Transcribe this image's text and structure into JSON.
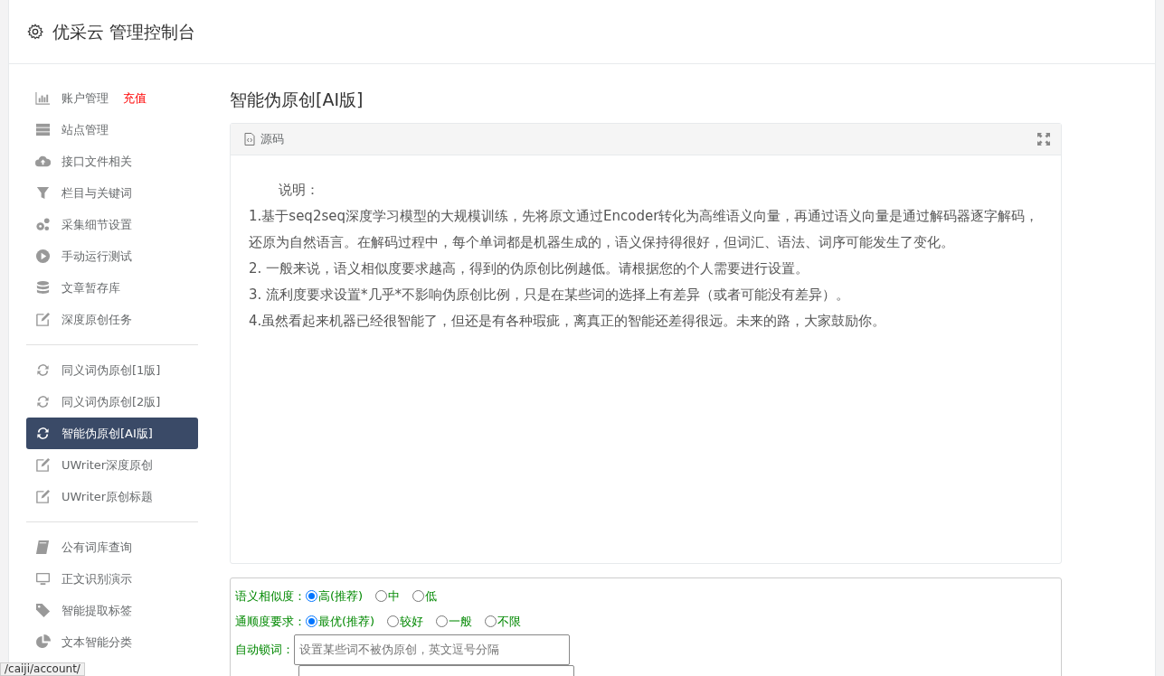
{
  "header": {
    "title": "优采云 管理控制台"
  },
  "sidebar": {
    "groups": [
      {
        "items": [
          {
            "label": "账户管理",
            "badge": "充值",
            "selected": false
          },
          {
            "label": "站点管理",
            "selected": false
          },
          {
            "label": "接口文件相关",
            "selected": false
          },
          {
            "label": "栏目与关键词",
            "selected": false
          },
          {
            "label": "采集细节设置",
            "selected": false
          },
          {
            "label": "手动运行测试",
            "selected": false
          },
          {
            "label": "文章暂存库",
            "selected": false
          },
          {
            "label": "深度原创任务",
            "selected": false
          }
        ]
      },
      {
        "items": [
          {
            "label": "同义词伪原创[1版]",
            "selected": false
          },
          {
            "label": "同义词伪原创[2版]",
            "selected": false
          },
          {
            "label": "智能伪原创[AI版]",
            "selected": true
          },
          {
            "label": "UWriter深度原创",
            "selected": false
          },
          {
            "label": "UWriter原创标题",
            "selected": false
          }
        ]
      },
      {
        "items": [
          {
            "label": "公有词库查询",
            "selected": false
          },
          {
            "label": "正文识别演示",
            "selected": false
          },
          {
            "label": "智能提取标签",
            "selected": false
          },
          {
            "label": "文本智能分类",
            "selected": false
          }
        ]
      }
    ]
  },
  "main": {
    "title": "智能伪原创[AI版]",
    "panel": {
      "tab": "源码",
      "intro": "说明：",
      "lines": [
        "1.基于seq2seq深度学习模型的大规模训练，先将原文通过Encoder转化为高维语义向量，再通过语义向量是通过解码器逐字解码，还原为自然语言。在解码过程中，每个单词都是机器生成的，语义保持得很好，但词汇、语法、词序可能发生了变化。",
        "2. 一般来说，语义相似度要求越高，得到的伪原创比例越低。请根据您的个人需要进行设置。",
        "3. 流利度要求设置*几乎*不影响伪原创比例，只是在某些词的选择上有差异（或者可能没有差异）。",
        "4.虽然看起来机器已经很智能了，但还是有各种瑕疵，离真正的智能还差得很远。未来的路，大家鼓励你。"
      ]
    },
    "form": {
      "radio_groups": [
        {
          "label": "语义相似度：",
          "options": [
            {
              "label": "高(推荐)",
              "selected": true
            },
            {
              "label": "中",
              "selected": false
            },
            {
              "label": "低",
              "selected": false
            }
          ]
        },
        {
          "label": "通顺度要求：",
          "options": [
            {
              "label": "最优(推荐)",
              "selected": true
            },
            {
              "label": "较好",
              "selected": false
            },
            {
              "label": "一般",
              "selected": false
            },
            {
              "label": "不限",
              "selected": false
            }
          ]
        }
      ],
      "lock_words": {
        "label": "自动锁词：",
        "placeholder": "设置某些词不被伪原创，英文逗号分隔"
      }
    }
  },
  "status_url": "/caiji/account/"
}
